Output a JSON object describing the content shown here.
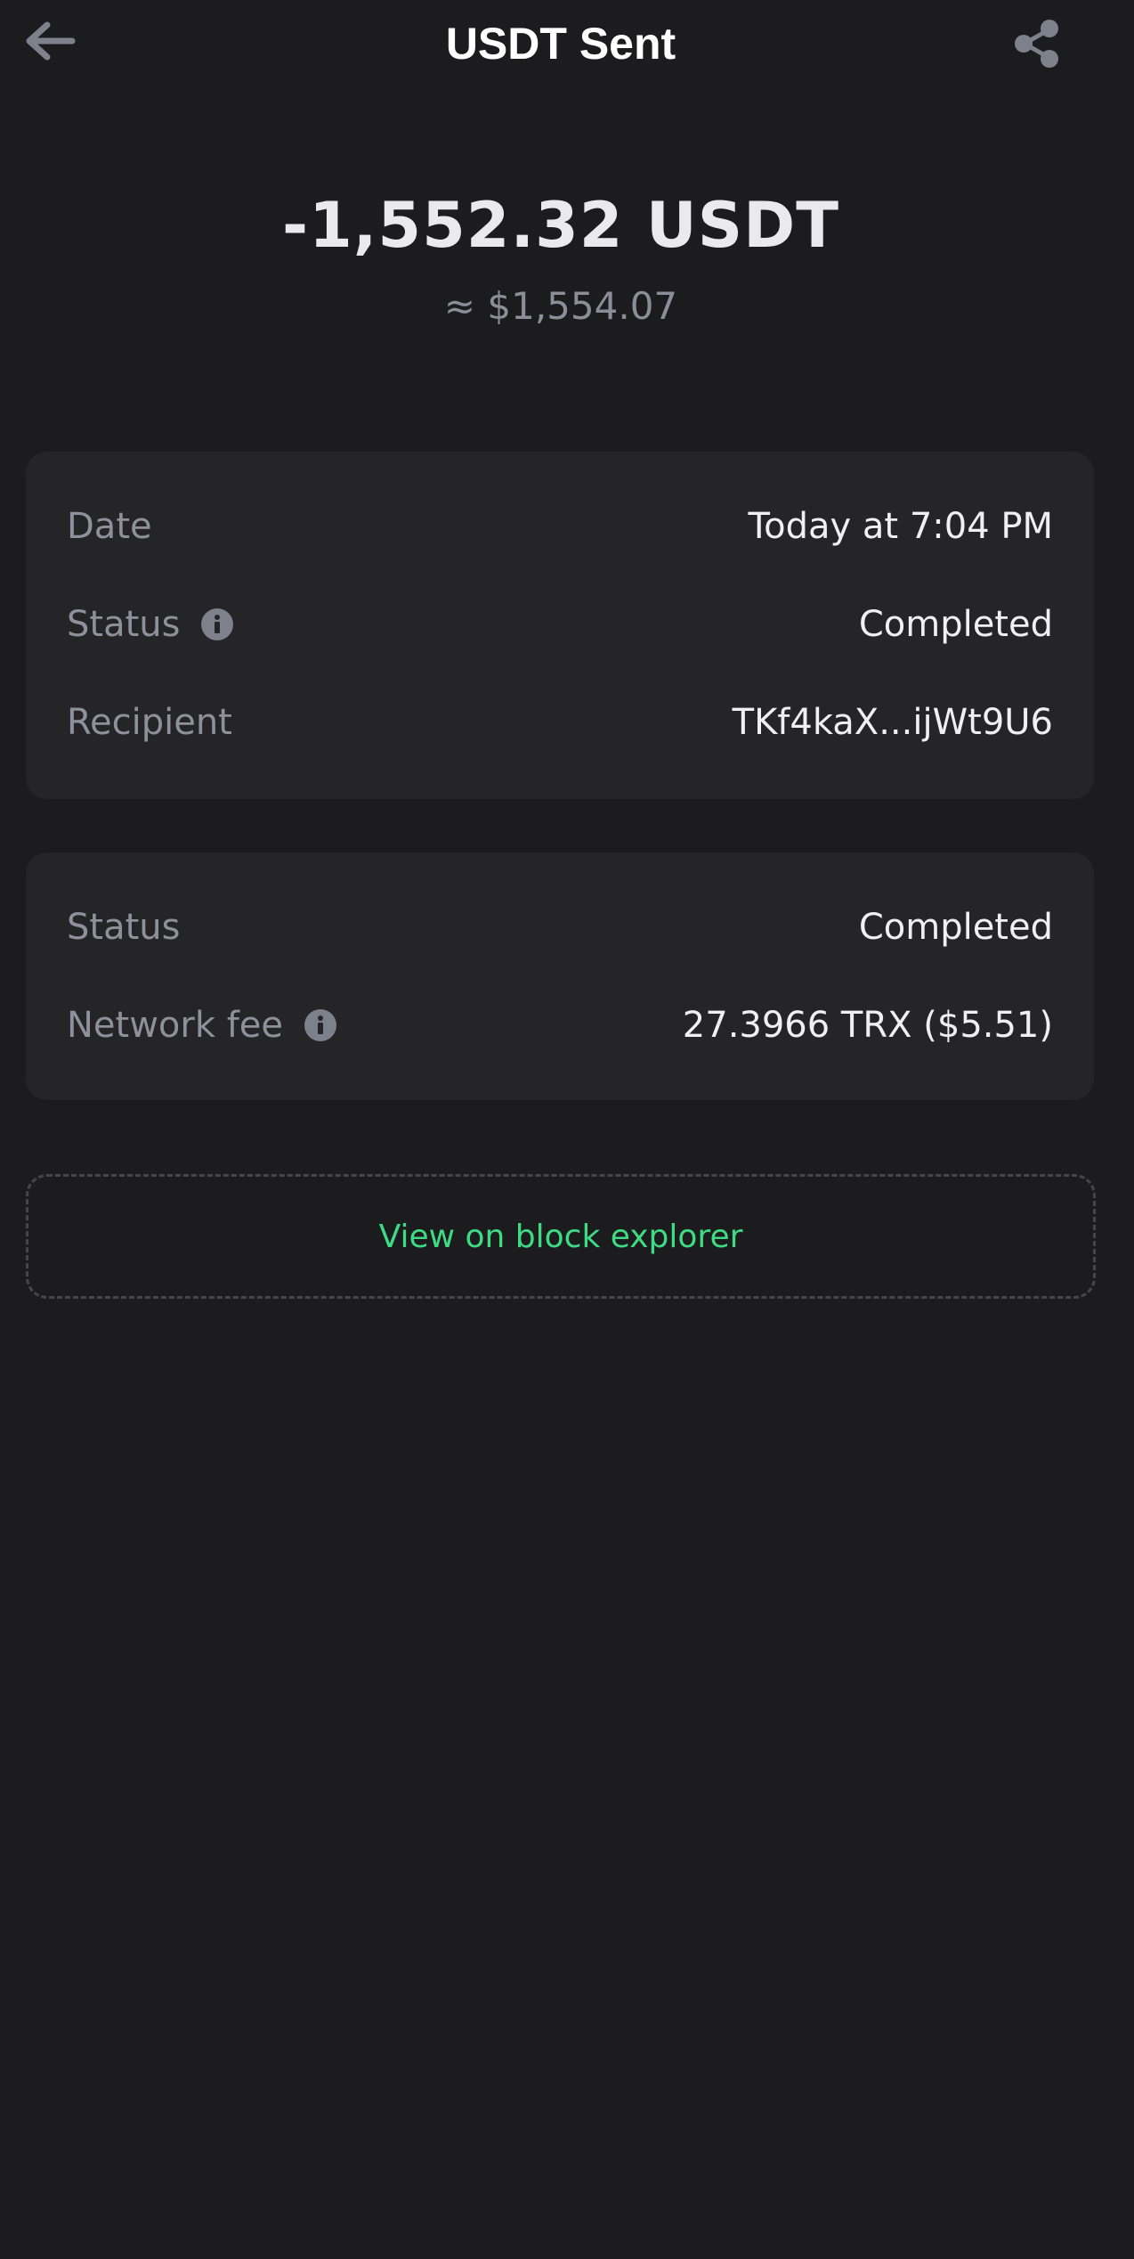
{
  "header": {
    "title": "USDT Sent",
    "back_icon": "arrow-left-icon",
    "share_icon": "share-icon"
  },
  "summary": {
    "amount": "-1,552.32 USDT",
    "fiat_value": "≈ $1,554.07"
  },
  "details_card": {
    "rows": [
      {
        "label": "Date",
        "value": "Today at 7:04 PM"
      },
      {
        "label": "Status",
        "value": "Completed",
        "info_icon": "info-icon"
      },
      {
        "label": "Recipient",
        "value": "TKf4kaX...ijWt9U6"
      }
    ]
  },
  "network_card": {
    "rows": [
      {
        "label": "Status",
        "value": "Completed"
      },
      {
        "label": "Network fee",
        "value": "27.3966 TRX ($5.51)",
        "info_icon": "info-icon"
      }
    ]
  },
  "actions": {
    "block_explorer_label": "View on block explorer"
  },
  "colors": {
    "background": "#1c1c1e",
    "card": "#252528",
    "label": "#8e919b",
    "value": "#f0f0f2",
    "accent": "#3ddc84"
  }
}
